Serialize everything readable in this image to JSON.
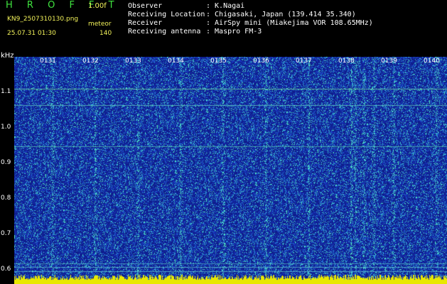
{
  "header": {
    "brand": "H R O F F T",
    "version": "1.00f",
    "filename": "KN9_2507310130.png",
    "meteor_label": "meteor",
    "datetime": "25.07.31 01:30",
    "meteor_count": "140"
  },
  "info": [
    {
      "label": "Observer",
      "value": ": K.Nagai"
    },
    {
      "label": "Receiving Location",
      "value": ": Chigasaki, Japan (139.414 35.340)"
    },
    {
      "label": "Receiver",
      "value": ": AirSpy mini (Miakejima VOR 108.65MHz)"
    },
    {
      "label": "Receiving antenna",
      "value": ": Maspro FM-3"
    }
  ],
  "axis": {
    "y_unit": "kHz",
    "y_ticks": [
      "1.1",
      "1.0",
      "0.9",
      "0.8",
      "0.7",
      "0.6"
    ],
    "x_ticks": [
      "0131",
      "0132",
      "0133",
      "0134",
      "0135",
      "0136",
      "0137",
      "0138",
      "0139",
      "0140"
    ]
  },
  "colors": {
    "background": "#000000",
    "spectrogram": "#1a2fb8",
    "header_green": "#3fe33f",
    "header_yellow": "#f2f25a"
  }
}
